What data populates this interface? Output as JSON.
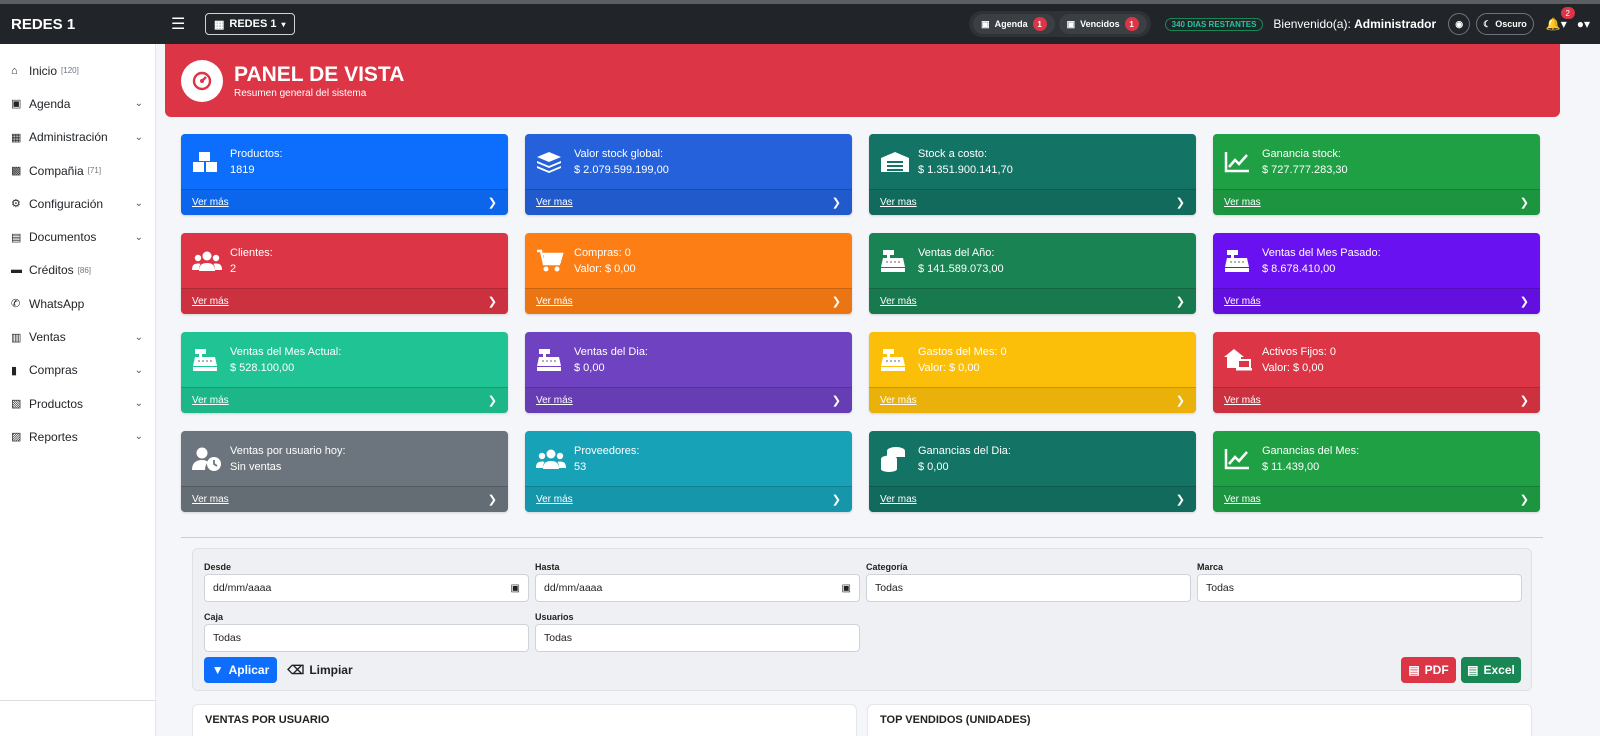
{
  "navbar": {
    "brand": "REDES 1",
    "company": "REDES 1",
    "agenda_label": "Agenda",
    "agenda_count": "1",
    "vencidos_label": "Vencidos",
    "vencidos_count": "1",
    "days_left": "340 DIAS RESTANTES",
    "welcome_prefix": "Bienvenido(a):",
    "welcome_user": "Administrador",
    "theme_label": "Oscuro",
    "notif_count": "2"
  },
  "sidebar": {
    "items": [
      {
        "label": "Inicio",
        "count": "[120]",
        "icon": "home-icon"
      },
      {
        "label": "Agenda",
        "icon": "calendar-icon",
        "expandable": true
      },
      {
        "label": "Administración",
        "icon": "id-card-icon",
        "expandable": true
      },
      {
        "label": "Compañia",
        "count": "[71]",
        "icon": "building-icon"
      },
      {
        "label": "Configuración",
        "icon": "gears-icon",
        "expandable": true
      },
      {
        "label": "Documentos",
        "icon": "folder-icon",
        "expandable": true
      },
      {
        "label": "Créditos",
        "count": "[86]",
        "icon": "credit-card-icon"
      },
      {
        "label": "WhatsApp",
        "icon": "whatsapp-icon"
      },
      {
        "label": "Ventas",
        "icon": "cash-register-icon",
        "expandable": true
      },
      {
        "label": "Compras",
        "icon": "cart-icon",
        "expandable": true
      },
      {
        "label": "Productos",
        "icon": "boxes-icon",
        "expandable": true
      },
      {
        "label": "Reportes",
        "icon": "chart-icon",
        "expandable": true
      }
    ]
  },
  "banner": {
    "title": "PANEL DE VISTA",
    "subtitle": "Resumen general del sistema"
  },
  "cards": [
    {
      "line1": "Productos:",
      "line2": "1819",
      "link": "Ver más",
      "color": "#0d6efd",
      "icon": "boxes-icon"
    },
    {
      "line1": "Valor stock global:",
      "line2": "$ 2.079.599.199,00",
      "link": "Ver mas",
      "color": "#2461db",
      "icon": "layers-icon"
    },
    {
      "line1": "Stock a costo:",
      "line2": "$ 1.351.900.141,70",
      "link": "Ver mas",
      "color": "#137364",
      "icon": "warehouse-icon"
    },
    {
      "line1": "Ganancia stock:",
      "line2": "$ 727.777.283,30",
      "link": "Ver mas",
      "color": "#1fa045",
      "icon": "chart-line-icon"
    },
    {
      "line1": "Clientes:",
      "line2": "2",
      "link": "Ver más",
      "color": "#dc3545",
      "icon": "users-icon"
    },
    {
      "line1": "Compras: 0",
      "line2": "Valor: $ 0,00",
      "link": "Ver más",
      "color": "#fd7e14",
      "icon": "cart-icon"
    },
    {
      "line1": "Ventas del Año:",
      "line2": "$ 141.589.073,00",
      "link": "Ver más",
      "color": "#1a8354",
      "icon": "cash-register-icon"
    },
    {
      "line1": "Ventas del Mes Pasado:",
      "line2": "$ 8.678.410,00",
      "link": "Ver más",
      "color": "#6a11f2",
      "icon": "cash-register-icon"
    },
    {
      "line1": "Ventas del Mes Actual:",
      "line2": "$ 528.100,00",
      "link": "Ver más",
      "color": "#20c494",
      "icon": "cash-register-icon"
    },
    {
      "line1": "Ventas del Dia:",
      "line2": "$ 0,00",
      "link": "Ver más",
      "color": "#6f42c1",
      "icon": "cash-register-icon"
    },
    {
      "line1": "Gastos del Mes: 0",
      "line2": "Valor: $ 0,00",
      "link": "Ver más",
      "color": "#fbbf0a",
      "icon": "cash-register-icon"
    },
    {
      "line1": "Activos Fijos: 0",
      "line2": "Valor: $ 0,00",
      "link": "Ver más",
      "color": "#dc3545",
      "icon": "house-laptop-icon"
    },
    {
      "line1": "Ventas por usuario hoy:",
      "line2": "Sin ventas",
      "link": "Ver mas",
      "color": "#6c757d",
      "icon": "user-clock-icon"
    },
    {
      "line1": "Proveedores:",
      "line2": "53",
      "link": "Ver más",
      "color": "#17a2b8",
      "icon": "users-icon"
    },
    {
      "line1": "Ganancias del Dia:",
      "line2": "$ 0,00",
      "link": "Ver mas",
      "color": "#137364",
      "icon": "coins-icon"
    },
    {
      "line1": "Ganancias del Mes:",
      "line2": "$ 11.439,00",
      "link": "Ver mas",
      "color": "#1fa045",
      "icon": "chart-line-icon"
    }
  ],
  "filters": {
    "desde_label": "Desde",
    "desde_value": "dd/mm/aaaa",
    "hasta_label": "Hasta",
    "hasta_value": "dd/mm/aaaa",
    "categoria_label": "Categoría",
    "categoria_value": "Todas",
    "marca_label": "Marca",
    "marca_value": "Todas",
    "caja_label": "Caja",
    "caja_value": "Todas",
    "usuarios_label": "Usuarios",
    "usuarios_value": "Todas",
    "apply_label": "Aplicar",
    "clear_label": "Limpiar",
    "pdf_label": "PDF",
    "excel_label": "Excel"
  },
  "panels": {
    "left_title": "VENTAS POR USUARIO",
    "right_title": "TOP VENDIDOS (UNIDADES)"
  }
}
